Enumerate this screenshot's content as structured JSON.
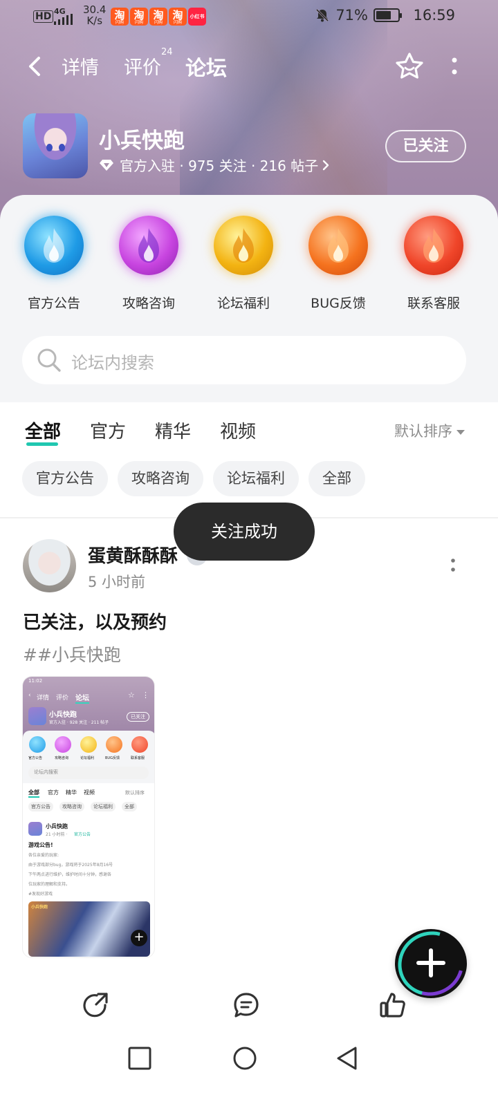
{
  "status_bar": {
    "hd": "HD",
    "network": "4G",
    "speed_value": "30.4",
    "speed_unit": "K/s",
    "apps": [
      {
        "name": "taobao",
        "glyph": "淘",
        "sub": "闪购"
      },
      {
        "name": "taobao",
        "glyph": "淘",
        "sub": "闪购"
      },
      {
        "name": "taobao",
        "glyph": "淘",
        "sub": "闪购"
      },
      {
        "name": "taobao",
        "glyph": "淘",
        "sub": "闪购"
      },
      {
        "name": "xiaohongshu",
        "glyph": "小红书"
      }
    ],
    "battery": "71%",
    "battery_level": 0.71,
    "time": "16:59"
  },
  "nav": {
    "tabs": [
      {
        "label": "详情"
      },
      {
        "label": "评价",
        "badge": "24"
      },
      {
        "label": "论坛",
        "active": true
      }
    ]
  },
  "game": {
    "title": "小兵快跑",
    "meta": "官方入驻 · 975 关注 · 216 帖子",
    "follow_button": "已关注"
  },
  "quick_links": [
    {
      "label": "官方公告",
      "color": "#1f9be6"
    },
    {
      "label": "攻略咨询",
      "color": "#c845e0"
    },
    {
      "label": "论坛福利",
      "color": "#f3b312"
    },
    {
      "label": "BUG反馈",
      "color": "#f5731f"
    },
    {
      "label": "联系客服",
      "color": "#f0462a"
    }
  ],
  "search": {
    "placeholder": "论坛内搜索"
  },
  "filter_tabs": [
    {
      "label": "全部",
      "active": true
    },
    {
      "label": "官方"
    },
    {
      "label": "精华"
    },
    {
      "label": "视频"
    }
  ],
  "sort_label": "默认排序",
  "chips": [
    "官方公告",
    "攻略咨询",
    "论坛福利",
    "全部"
  ],
  "toast": "关注成功",
  "post": {
    "author": "蛋黄酥酥酥",
    "time": "5 小时前",
    "title": "已关注，以及预约",
    "tag": "##小兵快跑",
    "thumbnail": {
      "time": "11:02",
      "tabs": [
        "详情",
        "评价",
        "论坛"
      ],
      "game_title": "小兵快跑",
      "game_meta": "官方入驻 · 928 关注 · 211 帖子",
      "follow": "已关注",
      "quick_labels": [
        "官方公告",
        "攻略咨询",
        "论坛福利",
        "BUG反馈",
        "联系客服"
      ],
      "search": "论坛内搜索",
      "filter_tabs": [
        "全部",
        "官方",
        "精华",
        "视频"
      ],
      "sort": "默认排序",
      "chips": [
        "官方公告",
        "攻略咨询",
        "论坛福利",
        "全部"
      ],
      "post_author": "小兵快跑",
      "post_time": "21 小时前 ·",
      "post_category": "官方公告",
      "post_title": "游戏公告!",
      "post_line1": "各位亲爱的玩家:",
      "post_line2": "由于游戏部分bug，游戏将于2025年8月16号",
      "post_line3": "下午两点进行维护，维护时间十分钟，感谢各",
      "post_line4": "位玩家的理解和支持。",
      "post_tag": "#发现好游戏",
      "image_logo": "小兵快跑"
    }
  },
  "accent": "#20c7b0"
}
